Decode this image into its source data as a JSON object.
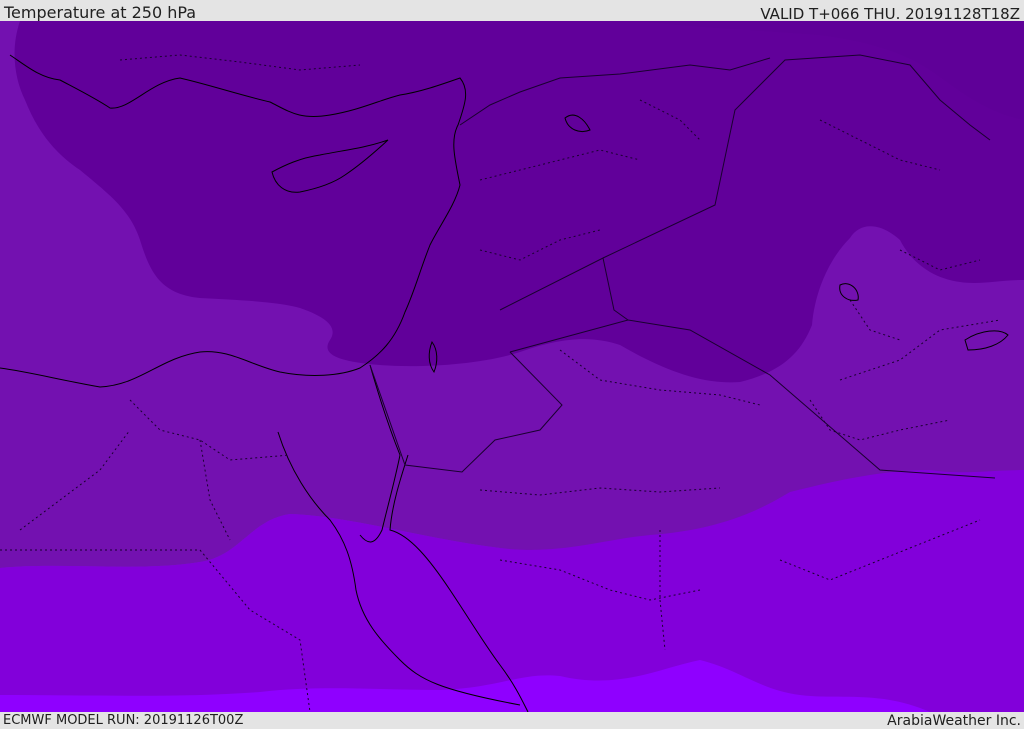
{
  "header": {
    "title": "Temperature at 250 hPa",
    "valid_time": "VALID T+066 THU. 20191128T18Z"
  },
  "footer": {
    "model_run": "ECMWF MODEL RUN: 20191126T00Z",
    "credit": "ArabiaWeather Inc."
  },
  "map": {
    "field": "temperature",
    "level": "250 hPa",
    "colors": {
      "band_darkest": "#61009a",
      "band_dark": "#7311b0",
      "band_mid": "#8200da",
      "band_light": "#8f00ff",
      "coastline": "#000000",
      "border": "#1a0030"
    }
  }
}
